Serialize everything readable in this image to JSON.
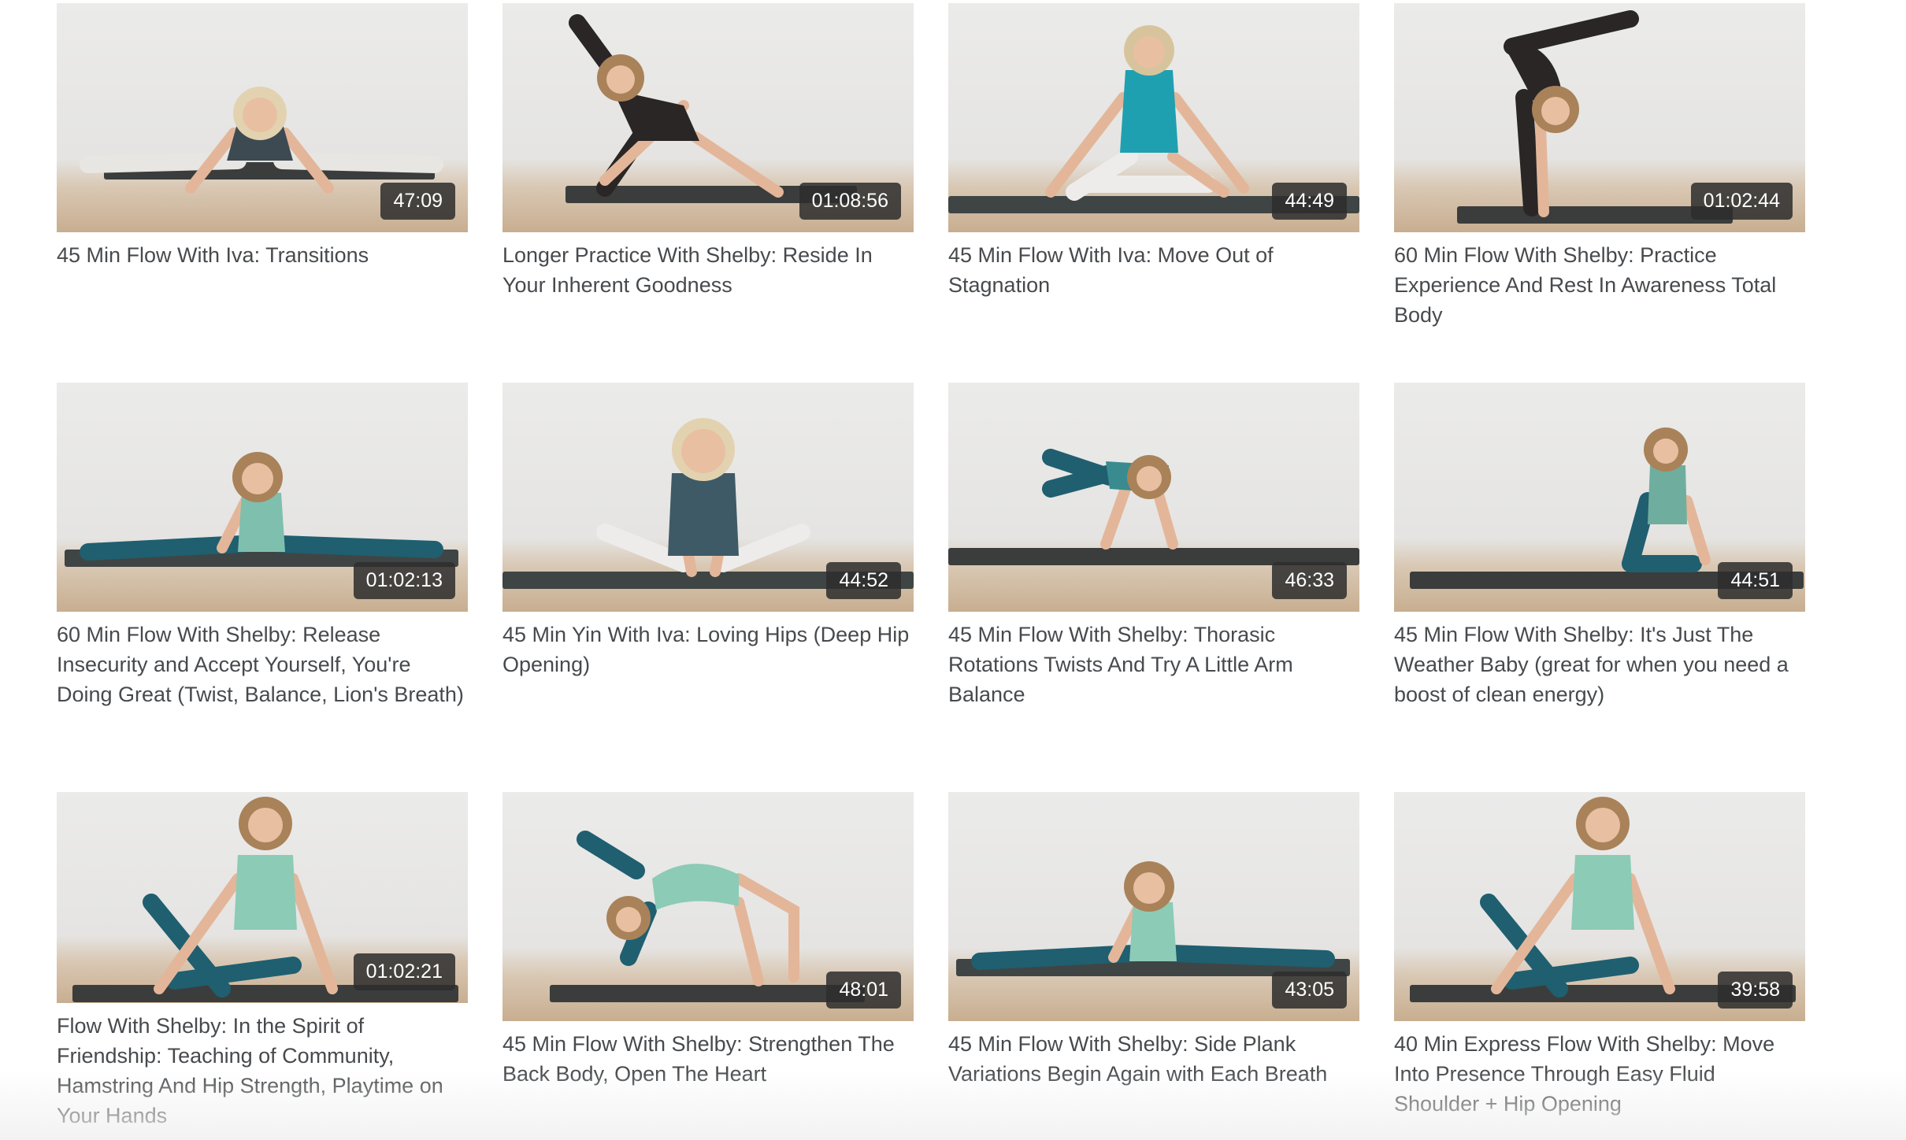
{
  "videos": [
    {
      "title": "45 Min Flow With Iva: Transitions",
      "duration": "47:09",
      "pose": "straddle",
      "hair": "#e2d2b0",
      "top": "#3e4a52",
      "legs": "#e8e6e2",
      "mat": "#3b3d3c"
    },
    {
      "title": "Longer Practice With Shelby: Reside In Your Inherent Goodness",
      "duration": "01:08:56",
      "pose": "triangle",
      "hair": "#a98259",
      "top": "#2a2626",
      "legs": "#2a2626",
      "mat": "#3b3d3c"
    },
    {
      "title": "45 Min Flow With Iva: Move Out of Stagnation",
      "duration": "44:49",
      "pose": "seated",
      "hair": "#d8c49c",
      "top": "#1fa0b0",
      "legs": "#eeeceb",
      "mat": "#3f4544"
    },
    {
      "title": "60 Min Flow With Shelby: Practice Experience And Rest In Awareness Total Body",
      "duration": "01:02:44",
      "pose": "backbend",
      "hair": "#a98259",
      "top": "#2a2626",
      "legs": "#2a2626",
      "mat": "#3b3d3c"
    },
    {
      "title": "60 Min Flow With Shelby: Release Insecurity and Accept Yourself, You're Doing Great (Twist, Balance, Lion's Breath)",
      "duration": "01:02:13",
      "pose": "splits",
      "hair": "#a98259",
      "top": "#7fbfae",
      "legs": "#1f5f70",
      "mat": "#3f4544"
    },
    {
      "title": "45 Min Yin With Iva: Loving Hips (Deep Hip Opening)",
      "duration": "44:52",
      "pose": "butterfly",
      "hair": "#e2d2b0",
      "top": "#3e5a66",
      "legs": "#eeeceb",
      "mat": "#3f4544"
    },
    {
      "title": "45 Min Flow With Shelby: Thorasic Rotations Twists And Try A Little Arm Balance",
      "duration": "46:33",
      "pose": "crow",
      "hair": "#a98259",
      "top": "#3a8b8f",
      "legs": "#1f5f70",
      "mat": "#3b3d3c"
    },
    {
      "title": "45 Min Flow With Shelby: It's Just The Weather Baby (great for when you need a boost of clean energy)",
      "duration": "44:51",
      "pose": "kneel",
      "hair": "#a98259",
      "top": "#6fae9e",
      "legs": "#1f5f70",
      "mat": "#3b3d3c"
    },
    {
      "title": "Flow With Shelby: In the Spirit of Friendship: Teaching of Community, Hamstring And Hip Strength, Playtime on Your Hands",
      "duration": "01:02:21",
      "pose": "sitlean",
      "hair": "#a98259",
      "top": "#8ccbb6",
      "legs": "#1f5f70",
      "mat": "#3b3d3c"
    },
    {
      "title": "45 Min Flow With Shelby: Strengthen The Back Body, Open The Heart",
      "duration": "48:01",
      "pose": "wildthing",
      "hair": "#a98259",
      "top": "#8ccbb6",
      "legs": "#1f5f70",
      "mat": "#3b3d3c"
    },
    {
      "title": "45 Min Flow With Shelby: Side Plank Variations Begin Again with Each Breath",
      "duration": "43:05",
      "pose": "splits",
      "hair": "#a98259",
      "top": "#8ccbb6",
      "legs": "#1f5f70",
      "mat": "#3f4544"
    },
    {
      "title": "40 Min Express Flow With Shelby: Move Into Presence Through Easy Fluid Shoulder + Hip Opening",
      "duration": "39:58",
      "pose": "sitlean",
      "hair": "#a98259",
      "top": "#8ccbb6",
      "legs": "#1f5f70",
      "mat": "#3b3d3c"
    }
  ]
}
